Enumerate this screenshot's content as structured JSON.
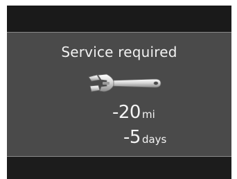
{
  "cluster": {
    "message": {
      "title": "Service required",
      "icon": "wrench-icon",
      "distance": {
        "value": "-20",
        "unit": "mi"
      },
      "time": {
        "value": "-5",
        "unit": "days"
      }
    }
  },
  "colors": {
    "panel_bg": "#4a4a4a",
    "frame_bg": "#141414",
    "text": "#f4f4f4"
  }
}
